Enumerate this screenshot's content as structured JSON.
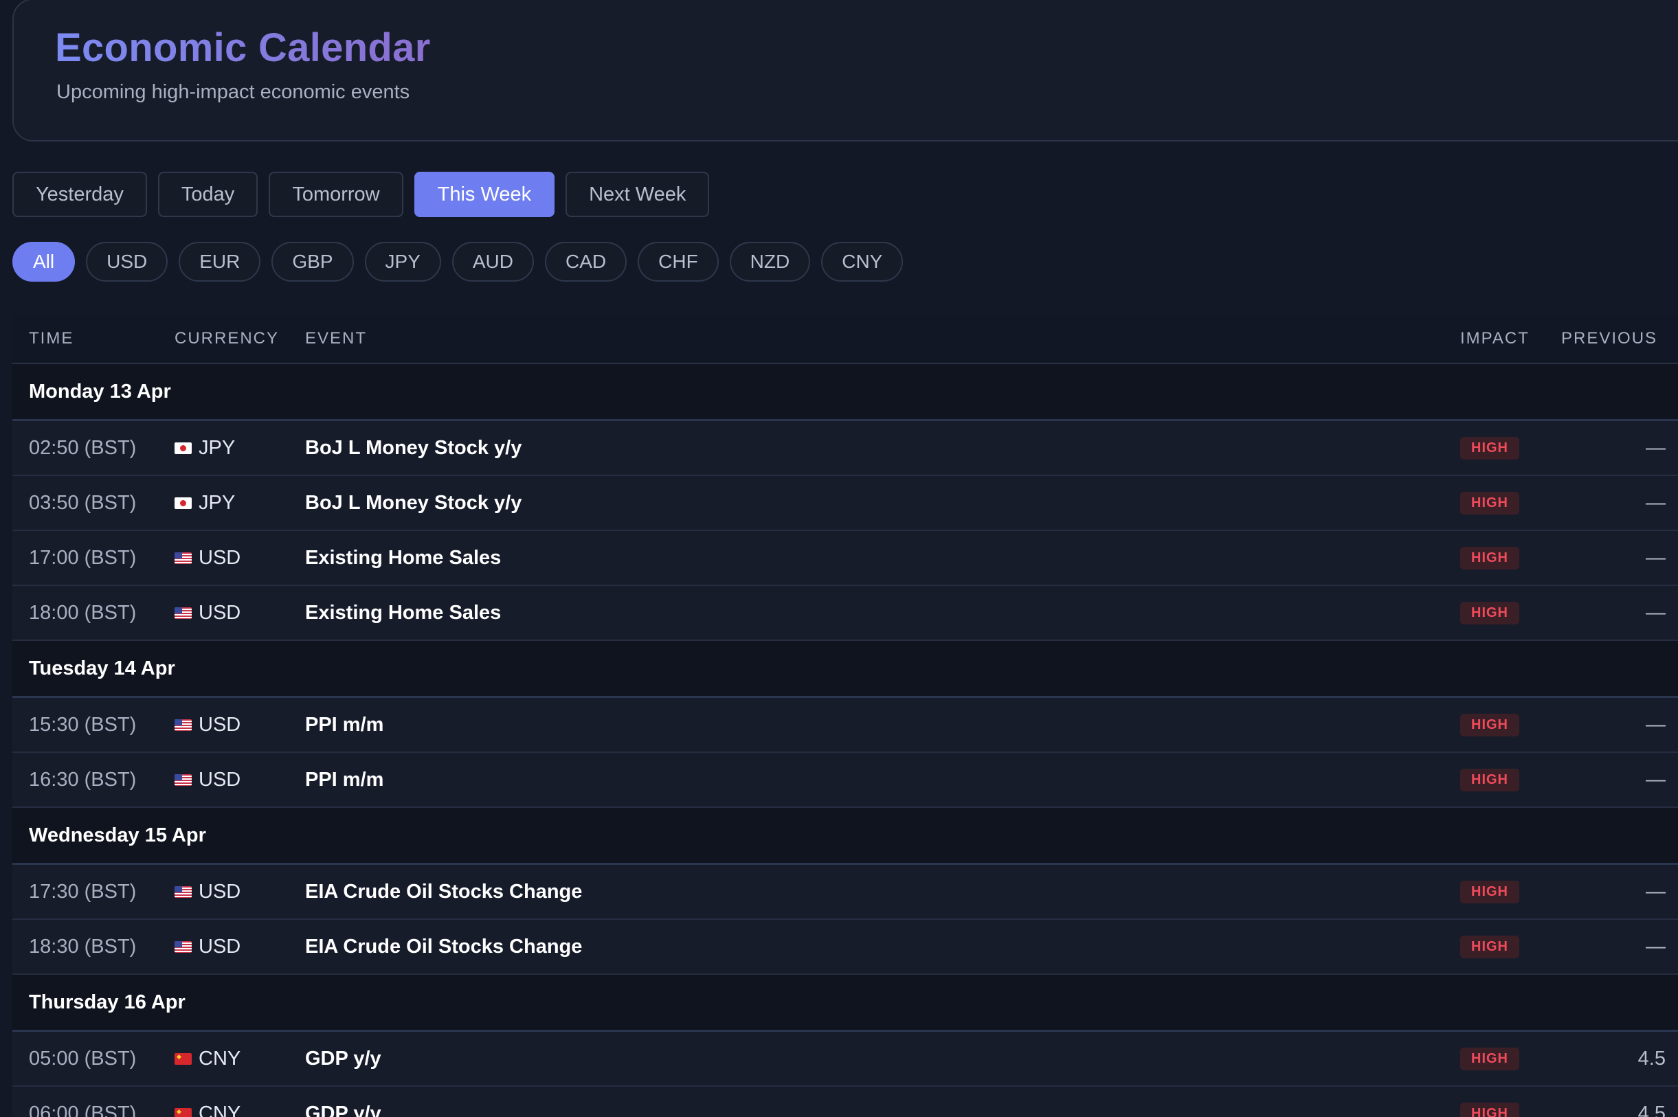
{
  "header": {
    "title": "Economic Calendar",
    "subtitle": "Upcoming high-impact economic events"
  },
  "date_tabs": [
    "Yesterday",
    "Today",
    "Tomorrow",
    "This Week",
    "Next Week"
  ],
  "active_date_tab": "This Week",
  "currency_filters": [
    "All",
    "USD",
    "EUR",
    "GBP",
    "JPY",
    "AUD",
    "CAD",
    "CHF",
    "NZD",
    "CNY"
  ],
  "active_currency": "All",
  "table": {
    "columns": {
      "time": "TIME",
      "currency": "CURRENCY",
      "event": "EVENT",
      "impact": "IMPACT",
      "previous": "PREVIOUS"
    },
    "groups": [
      {
        "day": "Monday 13 Apr",
        "rows": [
          {
            "time": "02:50 (BST)",
            "flag": "jp-flag-icon",
            "currency": "JPY",
            "event": "BoJ L Money Stock y/y",
            "impact": "HIGH",
            "previous": "—"
          },
          {
            "time": "03:50 (BST)",
            "flag": "jp-flag-icon",
            "currency": "JPY",
            "event": "BoJ L Money Stock y/y",
            "impact": "HIGH",
            "previous": "—"
          },
          {
            "time": "17:00 (BST)",
            "flag": "us-flag-icon",
            "currency": "USD",
            "event": "Existing Home Sales",
            "impact": "HIGH",
            "previous": "—"
          },
          {
            "time": "18:00 (BST)",
            "flag": "us-flag-icon",
            "currency": "USD",
            "event": "Existing Home Sales",
            "impact": "HIGH",
            "previous": "—"
          }
        ]
      },
      {
        "day": "Tuesday 14 Apr",
        "rows": [
          {
            "time": "15:30 (BST)",
            "flag": "us-flag-icon",
            "currency": "USD",
            "event": "PPI m/m",
            "impact": "HIGH",
            "previous": "—"
          },
          {
            "time": "16:30 (BST)",
            "flag": "us-flag-icon",
            "currency": "USD",
            "event": "PPI m/m",
            "impact": "HIGH",
            "previous": "—"
          }
        ]
      },
      {
        "day": "Wednesday 15 Apr",
        "rows": [
          {
            "time": "17:30 (BST)",
            "flag": "us-flag-icon",
            "currency": "USD",
            "event": "EIA Crude Oil Stocks Change",
            "impact": "HIGH",
            "previous": "—"
          },
          {
            "time": "18:30 (BST)",
            "flag": "us-flag-icon",
            "currency": "USD",
            "event": "EIA Crude Oil Stocks Change",
            "impact": "HIGH",
            "previous": "—"
          }
        ]
      },
      {
        "day": "Thursday 16 Apr",
        "rows": [
          {
            "time": "05:00 (BST)",
            "flag": "cn-flag-icon",
            "currency": "CNY",
            "event": "GDP y/y",
            "impact": "HIGH",
            "previous": "4.5"
          },
          {
            "time": "06:00 (BST)",
            "flag": "cn-flag-icon",
            "currency": "CNY",
            "event": "GDP y/y",
            "impact": "HIGH",
            "previous": "4.5"
          }
        ]
      }
    ]
  },
  "colors": {
    "accent": "#6e7ef0",
    "background": "#131826",
    "high_impact": "#ef4b5b"
  }
}
